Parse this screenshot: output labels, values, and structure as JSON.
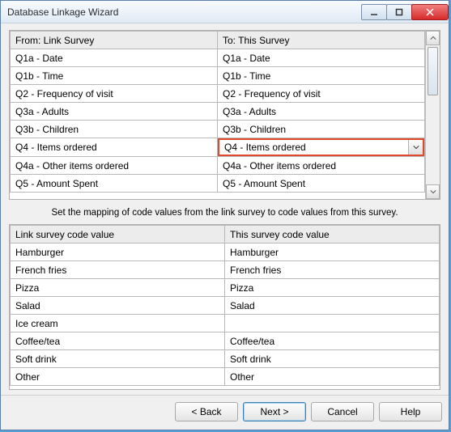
{
  "window": {
    "title": "Database Linkage Wizard"
  },
  "top_table": {
    "headers": {
      "from": "From: Link Survey",
      "to": "To: This Survey"
    },
    "rows": [
      {
        "from": "Q1a - Date",
        "to": "Q1a - Date"
      },
      {
        "from": "Q1b - Time",
        "to": "Q1b - Time"
      },
      {
        "from": "Q2 - Frequency of visit",
        "to": "Q2 - Frequency of visit"
      },
      {
        "from": "Q3a - Adults",
        "to": "Q3a - Adults"
      },
      {
        "from": "Q3b - Children",
        "to": "Q3b - Children"
      },
      {
        "from": "Q4 - Items ordered",
        "to": "Q4 - Items ordered"
      },
      {
        "from": "Q4a - Other items ordered",
        "to": "Q4a - Other items ordered"
      },
      {
        "from": "Q5 - Amount Spent",
        "to": "Q5 - Amount Spent"
      }
    ],
    "selected_row_index": 5
  },
  "message": "Set the mapping of code values from the link survey to code values from this survey.",
  "bottom_table": {
    "headers": {
      "link": "Link survey code value",
      "this": "This survey code value"
    },
    "rows": [
      {
        "link": "Hamburger",
        "this": "Hamburger"
      },
      {
        "link": "French fries",
        "this": "French fries"
      },
      {
        "link": "Pizza",
        "this": "Pizza"
      },
      {
        "link": "Salad",
        "this": "Salad"
      },
      {
        "link": "Ice cream",
        "this": ""
      },
      {
        "link": "Coffee/tea",
        "this": "Coffee/tea"
      },
      {
        "link": "Soft drink",
        "this": "Soft drink"
      },
      {
        "link": "Other",
        "this": "Other"
      }
    ]
  },
  "buttons": {
    "back": "< Back",
    "next": "Next >",
    "cancel": "Cancel",
    "help": "Help"
  }
}
